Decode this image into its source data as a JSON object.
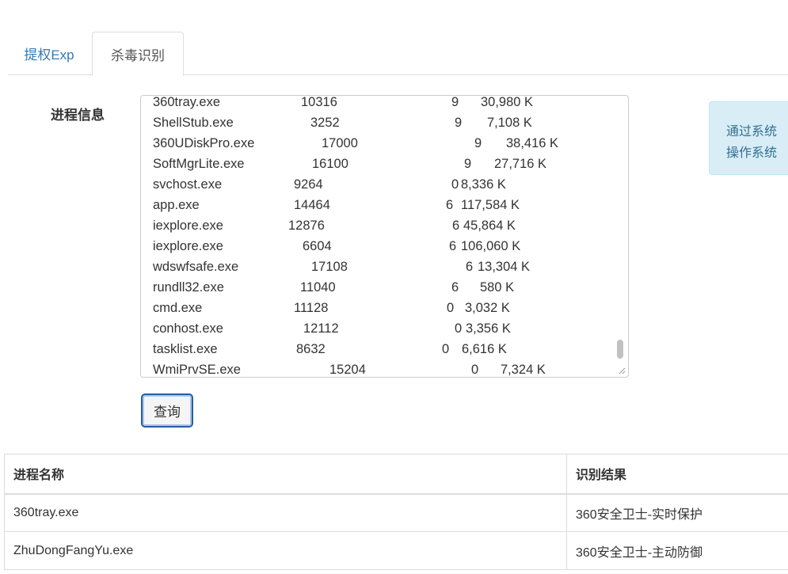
{
  "tabs": [
    {
      "label": "提权Exp",
      "active": false
    },
    {
      "label": "杀毒识别",
      "active": true
    }
  ],
  "form": {
    "label": "进程信息",
    "query_button": "查询"
  },
  "process_list": [
    {
      "name": "360tray.exe",
      "pid": "10316",
      "session": "9",
      "mem": "30,980 K"
    },
    {
      "name": "ShellStub.exe",
      "pid": "3252",
      "session": "9",
      "mem": "7,108 K"
    },
    {
      "name": "360UDiskPro.exe",
      "pid": "17000",
      "session": "9",
      "mem": "38,416 K"
    },
    {
      "name": "SoftMgrLite.exe",
      "pid": "16100",
      "session": "9",
      "mem": "27,716 K"
    },
    {
      "name": "svchost.exe",
      "pid": "9264",
      "session": "0",
      "mem": "8,336 K"
    },
    {
      "name": "app.exe",
      "pid": "14464",
      "session": "6",
      "mem": "117,584 K"
    },
    {
      "name": "iexplore.exe",
      "pid": "12876",
      "session": "6",
      "mem": "45,864 K"
    },
    {
      "name": "iexplore.exe",
      "pid": "6604",
      "session": "6",
      "mem": "106,060 K"
    },
    {
      "name": "wdswfsafe.exe",
      "pid": "17108",
      "session": "6",
      "mem": "13,304 K"
    },
    {
      "name": "rundll32.exe",
      "pid": "11040",
      "session": "6",
      "mem": "580 K"
    },
    {
      "name": "cmd.exe",
      "pid": "11128",
      "session": "0",
      "mem": "3,032 K"
    },
    {
      "name": "conhost.exe",
      "pid": "12112",
      "session": "0",
      "mem": "3,356 K"
    },
    {
      "name": "tasklist.exe",
      "pid": "8632",
      "session": "0",
      "mem": "6,616 K"
    },
    {
      "name": "WmiPrvSE.exe",
      "pid": "15204",
      "session": "0",
      "mem": "7,324 K"
    }
  ],
  "info": {
    "line1": "通过系统",
    "line2": "操作系统"
  },
  "results": {
    "headers": [
      "进程名称",
      "识别结果"
    ],
    "rows": [
      {
        "process": "360tray.exe",
        "result": "360安全卫士-实时保护"
      },
      {
        "process": "ZhuDongFangYu.exe",
        "result": "360安全卫士-主动防御"
      }
    ]
  }
}
